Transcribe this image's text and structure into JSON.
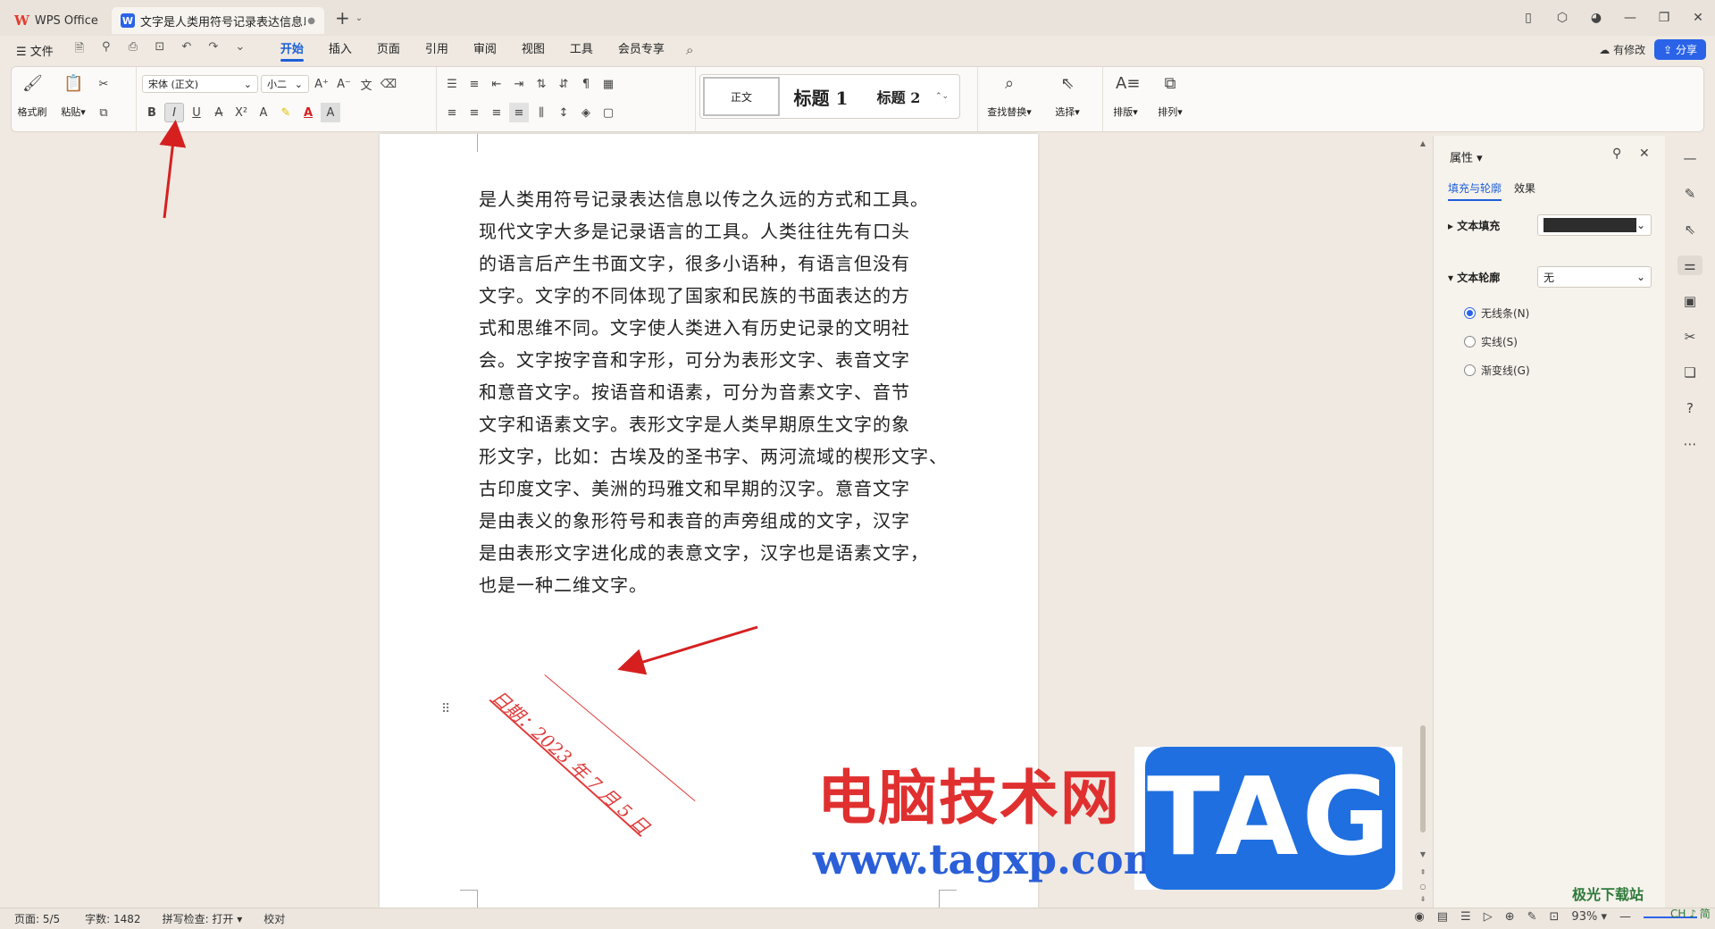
{
  "titlebar": {
    "home_tab": "WPS Office",
    "doc_tab": "文字是人类用符号记录表达信息以",
    "doc_tab_badge": "W"
  },
  "menubar": {
    "file": "文件",
    "tabs": [
      "开始",
      "插入",
      "页面",
      "引用",
      "审阅",
      "视图",
      "工具",
      "会员专享"
    ],
    "active_tab": "开始",
    "modified": "有修改",
    "share": "分享"
  },
  "ribbon": {
    "format_painter": "格式刷",
    "paste": "粘贴",
    "font_name": "宋体 (正文)",
    "font_size": "小二",
    "style_normal": "正文",
    "style_h1": "标题 1",
    "style_h2": "标题 2",
    "find_replace": "查找替换",
    "select": "选择",
    "layout": "排版",
    "arrange": "排列"
  },
  "document": {
    "lines": [
      "是人类用符号记录表达信息以传之久远的方式和工具。",
      "现代文字大多是记录语言的工具。人类往往先有口头",
      "的语言后产生书面文字，很多小语种，有语言但没有",
      "文字。文字的不同体现了国家和民族的书面表达的方",
      "式和思维不同。文字使人类进入有历史记录的文明社",
      "会。文字按字音和字形，可分为表形文字、表音文字",
      "和意音文字。按语音和语素，可分为音素文字、音节",
      "文字和语素文字。表形文字是人类早期原生文字的象",
      "形文字，比如：古埃及的圣书字、两河流域的楔形文字、",
      "古印度文字、美洲的玛雅文和早期的汉字。意音文字",
      "是由表义的象形符号和表音的声旁组成的文字，汉字",
      "是由表形文字进化成的表意文字，汉字也是语素文字，",
      "也是一种二维文字。"
    ],
    "date_text": "日期：2023 年 7 月 5 日",
    "date_color": "#e23b3b"
  },
  "properties": {
    "title": "属性",
    "tab_fill": "填充与轮廓",
    "tab_effect": "效果",
    "text_fill_label": "文本填充",
    "text_outline_label": "文本轮廓",
    "outline_value": "无",
    "radio_none": "无线条(N)",
    "radio_solid": "实线(S)",
    "radio_gradient": "渐变线(G)"
  },
  "statusbar": {
    "page": "页面: 5/5",
    "words": "字数: 1482",
    "spell": "拼写检查: 打开",
    "proof": "校对",
    "zoom": "93%"
  },
  "watermark": {
    "cn": "电脑技术网",
    "url": "www.tagxp.com",
    "tag": "TAG",
    "site": "极光下载站",
    "site2": "CH ♪ 简"
  },
  "colors": {
    "accent": "#1c5fd8",
    "annotation_arrow": "#d62020"
  }
}
